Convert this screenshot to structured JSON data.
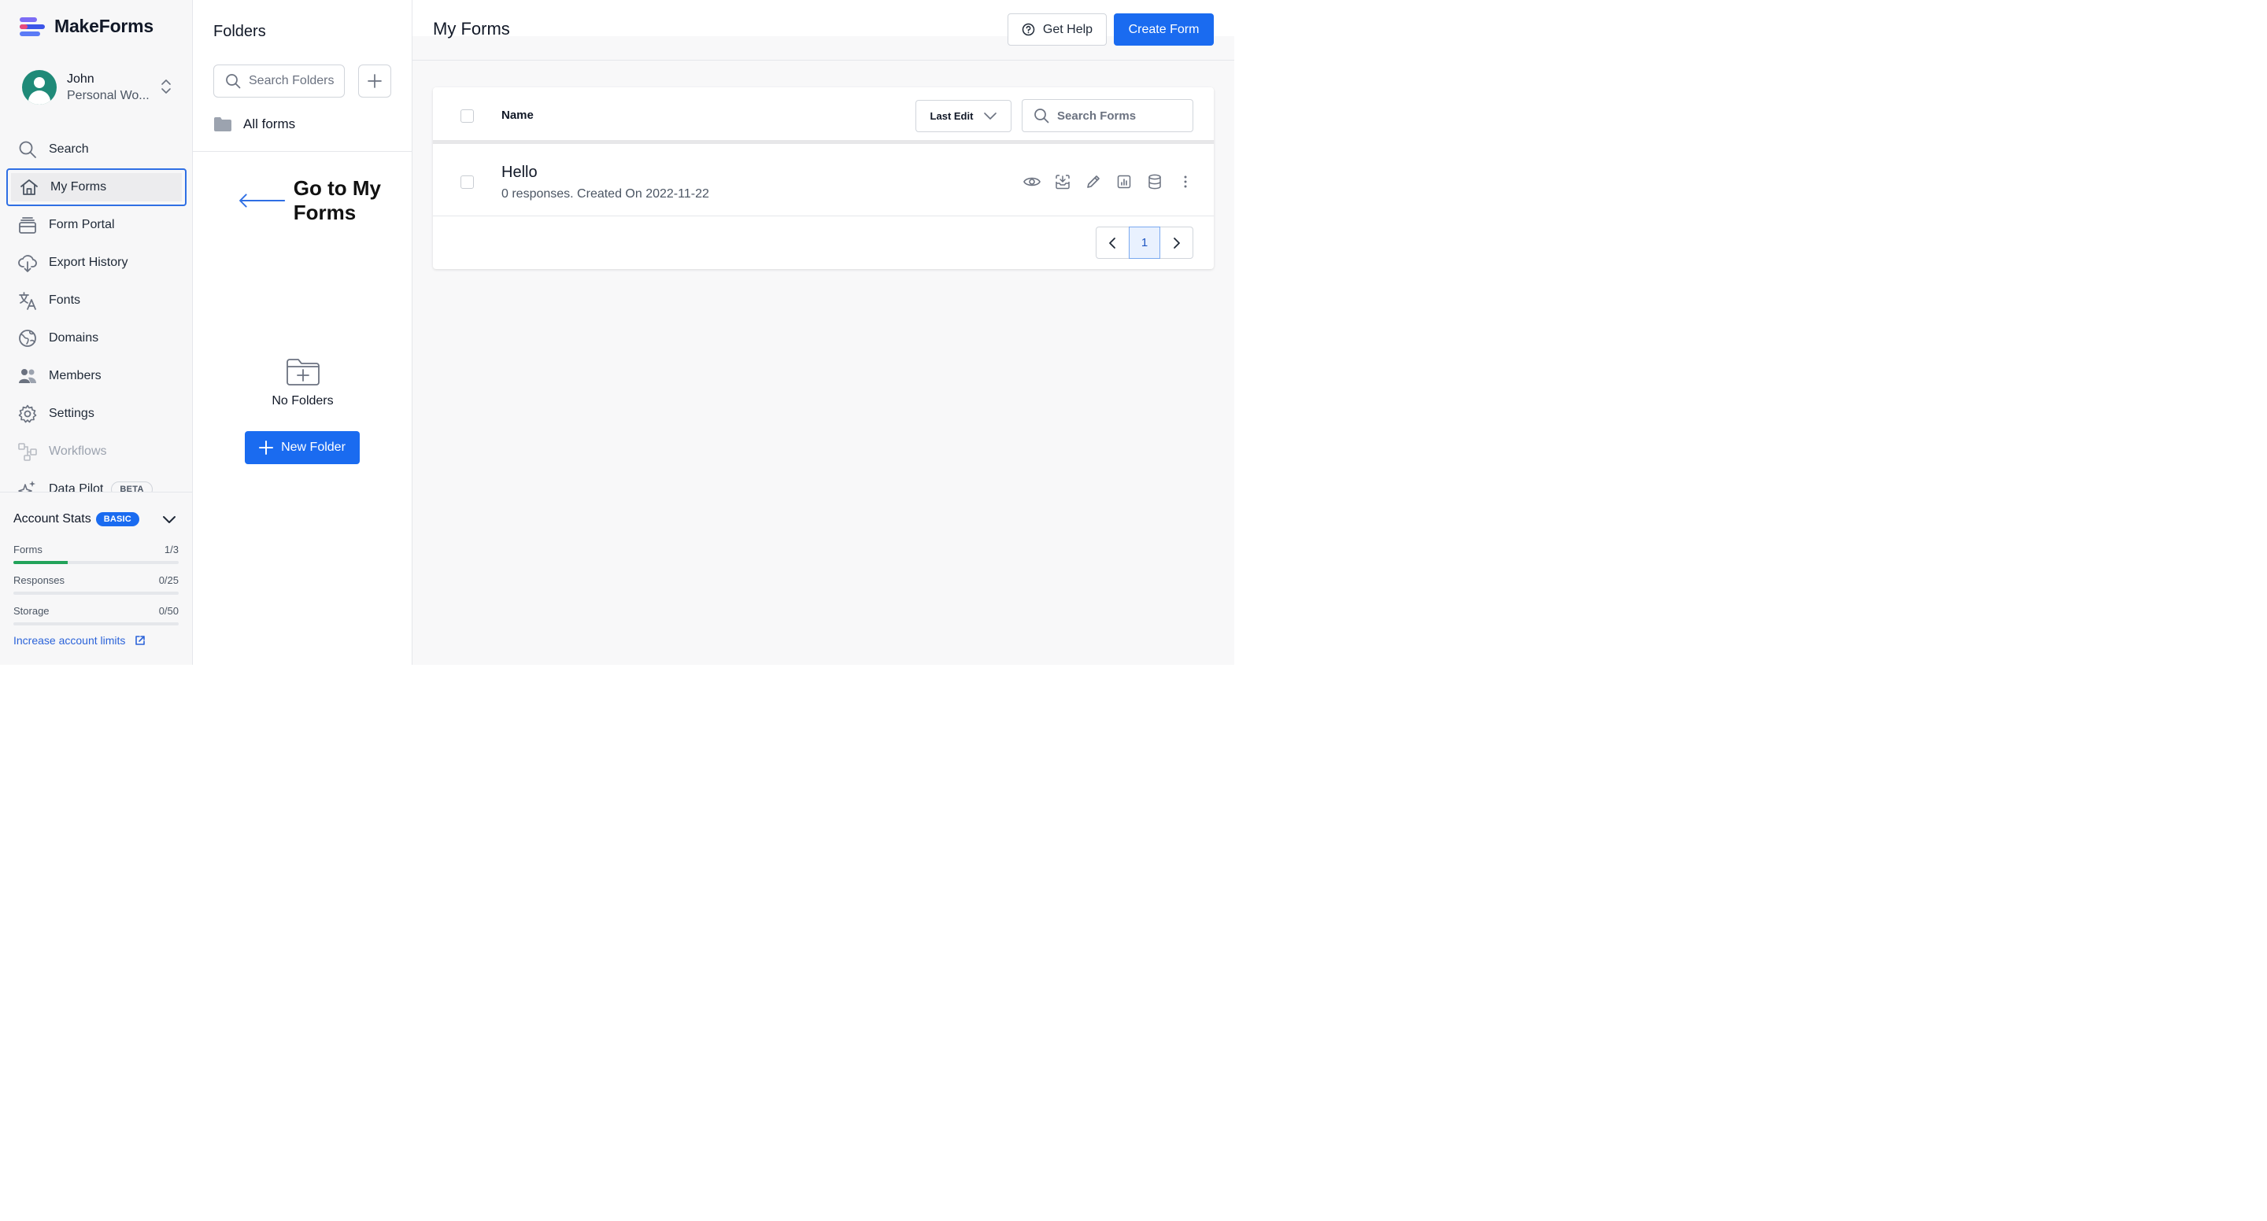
{
  "app": {
    "name": "MakeForms"
  },
  "colors": {
    "accent": "#1a6bf0",
    "annotation": "#2f6fe4",
    "progress": "#22a35a"
  },
  "account": {
    "name": "John",
    "workspace": "Personal Wo..."
  },
  "nav": {
    "items": [
      {
        "label": "Search",
        "icon": "search-icon"
      },
      {
        "label": "My Forms",
        "icon": "home-icon",
        "active": true
      },
      {
        "label": "Form Portal",
        "icon": "portal-icon"
      },
      {
        "label": "Export History",
        "icon": "cloud-download-icon"
      },
      {
        "label": "Fonts",
        "icon": "translate-icon"
      },
      {
        "label": "Domains",
        "icon": "globe-icon"
      },
      {
        "label": "Members",
        "icon": "users-icon"
      },
      {
        "label": "Settings",
        "icon": "gear-icon"
      },
      {
        "label": "Workflows",
        "icon": "workflow-icon",
        "disabled": true
      },
      {
        "label": "Data Pilot",
        "icon": "sparkle-icon",
        "badge": "BETA"
      }
    ]
  },
  "stats": {
    "title": "Account Stats",
    "plan": "BASIC",
    "rows": [
      {
        "label": "Forms",
        "value": "1/3",
        "fraction": 0.33
      },
      {
        "label": "Responses",
        "value": "0/25",
        "fraction": 0
      },
      {
        "label": "Storage",
        "value": "0/50",
        "fraction": 0
      }
    ],
    "increase_link": "Increase account limits"
  },
  "folders": {
    "title": "Folders",
    "search_placeholder": "Search Folders",
    "all_forms": "All forms",
    "empty_label": "No Folders",
    "new_folder": "New Folder"
  },
  "annotation": {
    "text": "Go to My Forms"
  },
  "main": {
    "title": "My Forms",
    "get_help": "Get Help",
    "create_form": "Create Form",
    "table": {
      "name_header": "Name",
      "sort_label": "Last Edit",
      "search_placeholder": "Search Forms",
      "rows": [
        {
          "title": "Hello",
          "subtitle": "0 responses. Created On 2022-11-22"
        }
      ],
      "current_page": "1"
    }
  }
}
